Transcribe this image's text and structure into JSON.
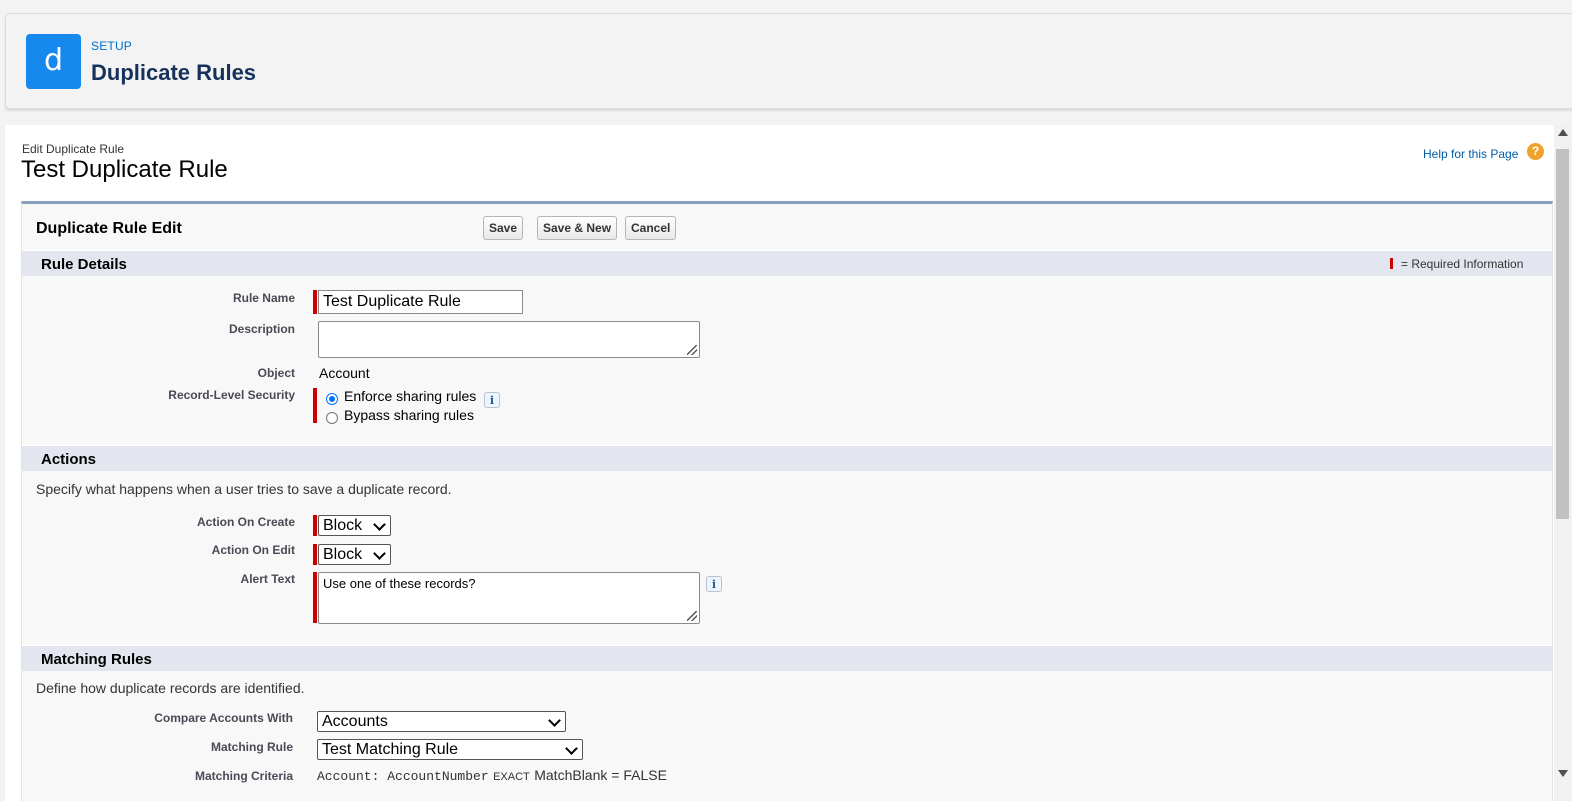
{
  "header": {
    "app_icon_letter": "d",
    "setup_label": "SETUP",
    "title": "Duplicate Rules"
  },
  "page": {
    "edit_label": "Edit Duplicate Rule",
    "record_title": "Test Duplicate Rule",
    "help_link": "Help for this Page",
    "help_icon": "?"
  },
  "block": {
    "title": "Duplicate Rule Edit",
    "buttons": {
      "save": "Save",
      "save_new": "Save & New",
      "cancel": "Cancel"
    }
  },
  "rule_details": {
    "title": "Rule Details",
    "required_legend": "= Required Information",
    "rule_name_label": "Rule Name",
    "rule_name_value": "Test Duplicate Rule",
    "description_label": "Description",
    "description_value": "",
    "object_label": "Object",
    "object_value": "Account",
    "security_label": "Record-Level Security",
    "security_options": [
      "Enforce sharing rules",
      "Bypass sharing rules"
    ],
    "security_selected": "Enforce sharing rules",
    "info_icon": "i"
  },
  "actions": {
    "title": "Actions",
    "description": "Specify what happens when a user tries to save a duplicate record.",
    "on_create_label": "Action On Create",
    "on_create_value": "Block",
    "on_edit_label": "Action On Edit",
    "on_edit_value": "Block",
    "alert_label": "Alert Text",
    "alert_value": "Use one of these records?",
    "info_icon": "i"
  },
  "matching_rules": {
    "title": "Matching Rules",
    "description": "Define how duplicate records are identified.",
    "compare_label": "Compare Accounts With",
    "compare_value": "Accounts",
    "matching_rule_label": "Matching Rule",
    "matching_rule_value": "Test Matching Rule",
    "criteria_label": "Matching Criteria",
    "criteria_field": "Account: AccountNumber",
    "criteria_method": "EXACT",
    "criteria_blank": "MatchBlank = FALSE"
  }
}
